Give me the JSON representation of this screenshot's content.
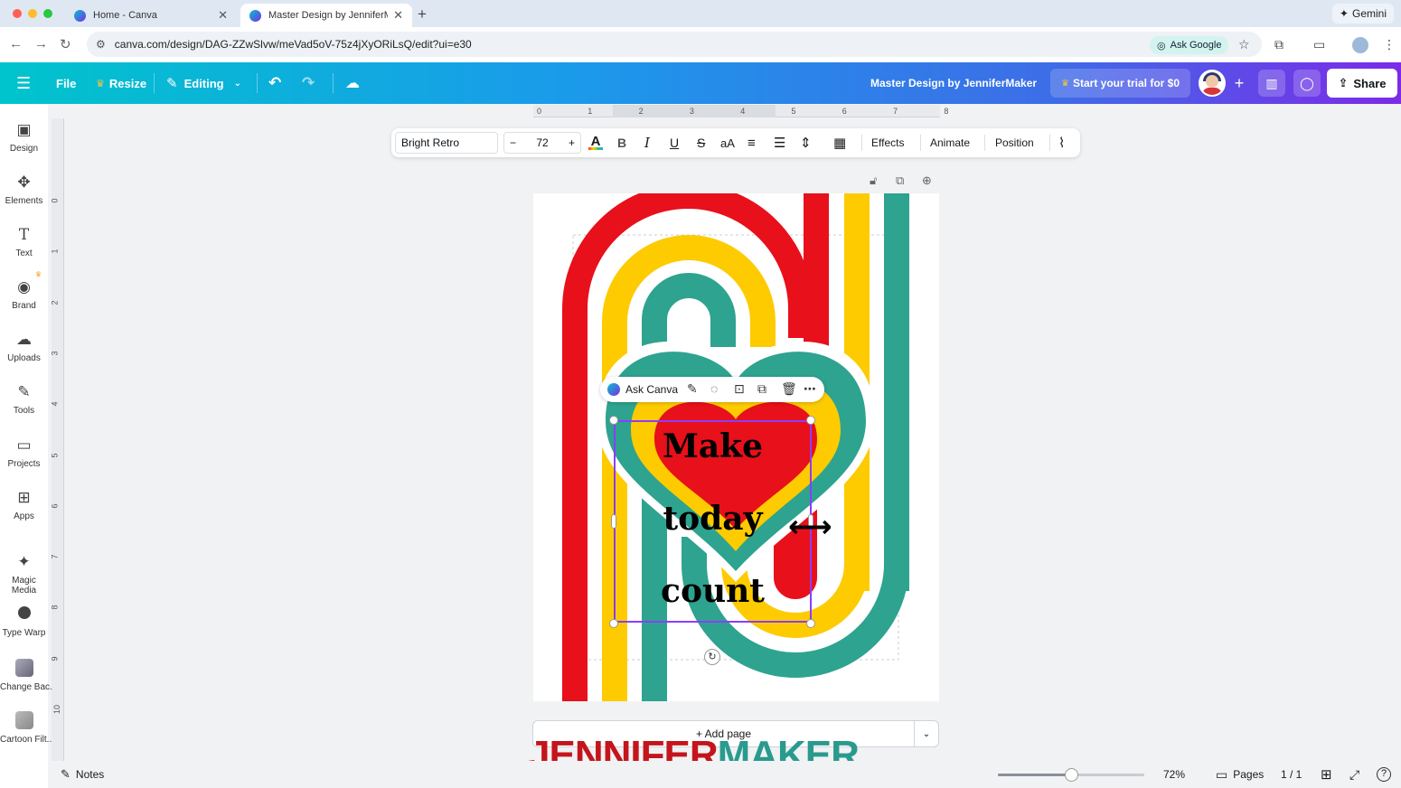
{
  "browser": {
    "tabs": [
      {
        "title": "Home - Canva"
      },
      {
        "title": "Master Design by JenniferMa"
      }
    ],
    "gemini_label": "Gemini",
    "url": "canva.com/design/DAG-ZZwSlvw/meVad5oV-75z4jXyORiLsQ/edit?ui=e30",
    "ask_google_label": "Ask Google"
  },
  "topbar": {
    "file_label": "File",
    "resize_label": "Resize",
    "editing_label": "Editing",
    "design_title": "Master Design by JenniferMaker",
    "trial_label": "Start your trial for $0",
    "share_label": "Share"
  },
  "sidebar": {
    "items": [
      {
        "label": "Design",
        "icon": "design-icon"
      },
      {
        "label": "Elements",
        "icon": "elements-icon"
      },
      {
        "label": "Text",
        "icon": "text-icon"
      },
      {
        "label": "Brand",
        "icon": "brand-icon"
      },
      {
        "label": "Uploads",
        "icon": "upload-cloud-icon"
      },
      {
        "label": "Tools",
        "icon": "pen-icon"
      },
      {
        "label": "Projects",
        "icon": "folder-icon"
      },
      {
        "label": "Apps",
        "icon": "apps-icon"
      },
      {
        "label": "Magic Media",
        "icon": "magic-media-icon"
      },
      {
        "label": "Type Warp",
        "icon": "type-warp-icon"
      },
      {
        "label": "Change Bac...",
        "icon": "change-background-icon"
      },
      {
        "label": "Cartoon Filt...",
        "icon": "cartoon-filter-icon"
      }
    ]
  },
  "rulers": {
    "top_ticks": [
      "0",
      "1",
      "2",
      "3",
      "4",
      "5",
      "6",
      "7",
      "8"
    ],
    "left_ticks": [
      "0",
      "1",
      "2",
      "3",
      "4",
      "5",
      "6",
      "7",
      "8",
      "9",
      "10"
    ]
  },
  "text_toolbar": {
    "font_name": "Bright Retro",
    "font_size": "72",
    "minus": "−",
    "plus": "+",
    "effects_label": "Effects",
    "animate_label": "Animate",
    "position_label": "Position"
  },
  "canvas": {
    "ask_canva_label": "Ask Canva",
    "text_lines": [
      "Make",
      "today",
      "count"
    ],
    "colors": {
      "red": "#e8101a",
      "yellow": "#fdcb00",
      "teal": "#2ea38f",
      "black": "#000000",
      "white": "#ffffff"
    }
  },
  "add_page_label": "+ Add page",
  "watermark": {
    "part1": "JENNIFER",
    "part2": "MAKER",
    "color1": "#c4151c",
    "color2": "#2a9a8e"
  },
  "bottombar": {
    "notes_label": "Notes",
    "zoom_level": "72%",
    "zoom_fraction": 0.5,
    "pages_label": "Pages",
    "page_count": "1 / 1",
    "help_label": "?"
  }
}
